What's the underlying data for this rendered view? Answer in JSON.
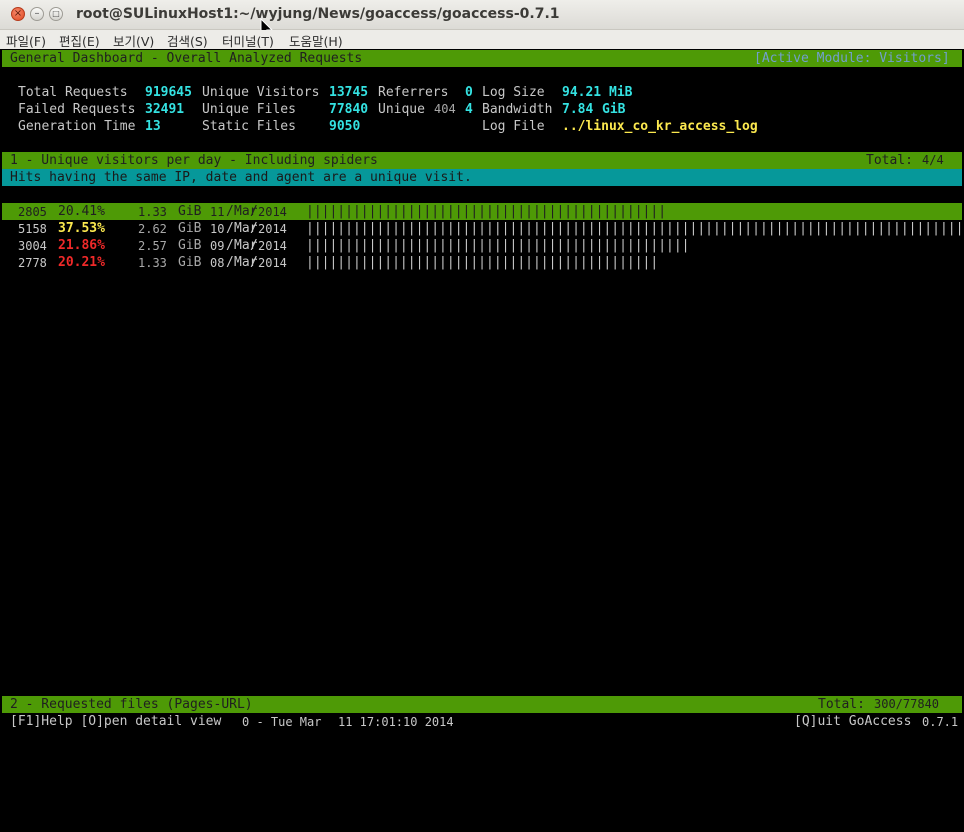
{
  "window": {
    "title": "root@SULinuxHost1:~/wyjung/News/goaccess/goaccess-0.7.1",
    "close_glyph": "×",
    "minimize_glyph": "–",
    "maximize_glyph": "□"
  },
  "menu": [
    "파일(F)",
    "편집(E)",
    "보기(V)",
    "검색(S)",
    "터미널(T)",
    "도움말(H)"
  ],
  "header": {
    "title": "General Dashboard - Overall Analyzed Requests",
    "active_module": "[Active Module: Visitors]"
  },
  "overview": {
    "total_requests_label": "Total Requests",
    "total_requests": "919645",
    "unique_visitors_label": "Unique Visitors",
    "unique_visitors": "13745",
    "referrers_label": "Referrers",
    "referrers": "0",
    "log_size_label": "Log Size",
    "log_size_value": "94.21",
    "log_size_unit": "MiB",
    "failed_requests_label": "Failed Requests",
    "failed_requests": "32491",
    "unique_files_label": "Unique Files",
    "unique_files": "77840",
    "unique404_label": "Unique",
    "unique404_code": "404",
    "unique404": "4",
    "bandwidth_label": "Bandwidth",
    "bandwidth_value": "7.84",
    "bandwidth_unit": "GiB",
    "generation_time_label": "Generation Time",
    "generation_time": "13",
    "static_files_label": "Static Files",
    "static_files": "9050",
    "log_file_label": "Log File",
    "log_file": "../linux_co_kr_access_log"
  },
  "module1": {
    "title": "1 - Unique visitors per day - Including spiders",
    "total_label": "Total:",
    "total": "4/4",
    "description": "Hits having the same IP, date and agent are a unique visit."
  },
  "visitors": [
    {
      "hits": "2805",
      "percent": "20.41%",
      "bw_value": "1.33",
      "bw_unit": "GiB",
      "day": "11",
      "month": "Mar",
      "year": "2014",
      "bars": "||||||||||||||||||||||||||||||||||||||||||||||",
      "fill": 0.544,
      "selected": true,
      "pct_color": "gray"
    },
    {
      "hits": "5158",
      "percent": "37.53%",
      "bw_value": "2.62",
      "bw_unit": "GiB",
      "day": "10",
      "month": "Mar",
      "year": "2014",
      "bars": "|||||||||||||||||||||||||||||||||||||||||||||||||||||||||||||||||||||||||||||||||||||||",
      "fill": 1.0,
      "selected": false,
      "pct_color": "yel"
    },
    {
      "hits": "3004",
      "percent": "21.86%",
      "bw_value": "2.57",
      "bw_unit": "GiB",
      "day": "09",
      "month": "Mar",
      "year": "2014",
      "bars": "|||||||||||||||||||||||||||||||||||||||||||||||||",
      "fill": 0.582,
      "selected": false,
      "pct_color": "red"
    },
    {
      "hits": "2778",
      "percent": "20.21%",
      "bw_value": "1.33",
      "bw_unit": "GiB",
      "day": "08",
      "month": "Mar",
      "year": "2014",
      "bars": "||||||||||||||||||||||||||||||||||||||||||||||",
      "fill": 0.539,
      "selected": false,
      "pct_color": "red"
    }
  ],
  "module2": {
    "title": "2 - Requested files (Pages-URL)",
    "total_label": "Total:",
    "total": "300/77840"
  },
  "status": {
    "help": "[F1]Help [O]pen detail view",
    "time_prefix": "0 - Tue Mar",
    "time": "11 17:01:10 2014",
    "quit": "[Q]uit GoAccess",
    "version": "0.7.1"
  },
  "colors": {
    "green_bar": "#4e9a06",
    "teal_bar": "#06989a",
    "cyan_value": "#34e2e2",
    "yellow_value": "#fce94f",
    "red_value": "#ef2929",
    "module_label": "#729fcf"
  }
}
